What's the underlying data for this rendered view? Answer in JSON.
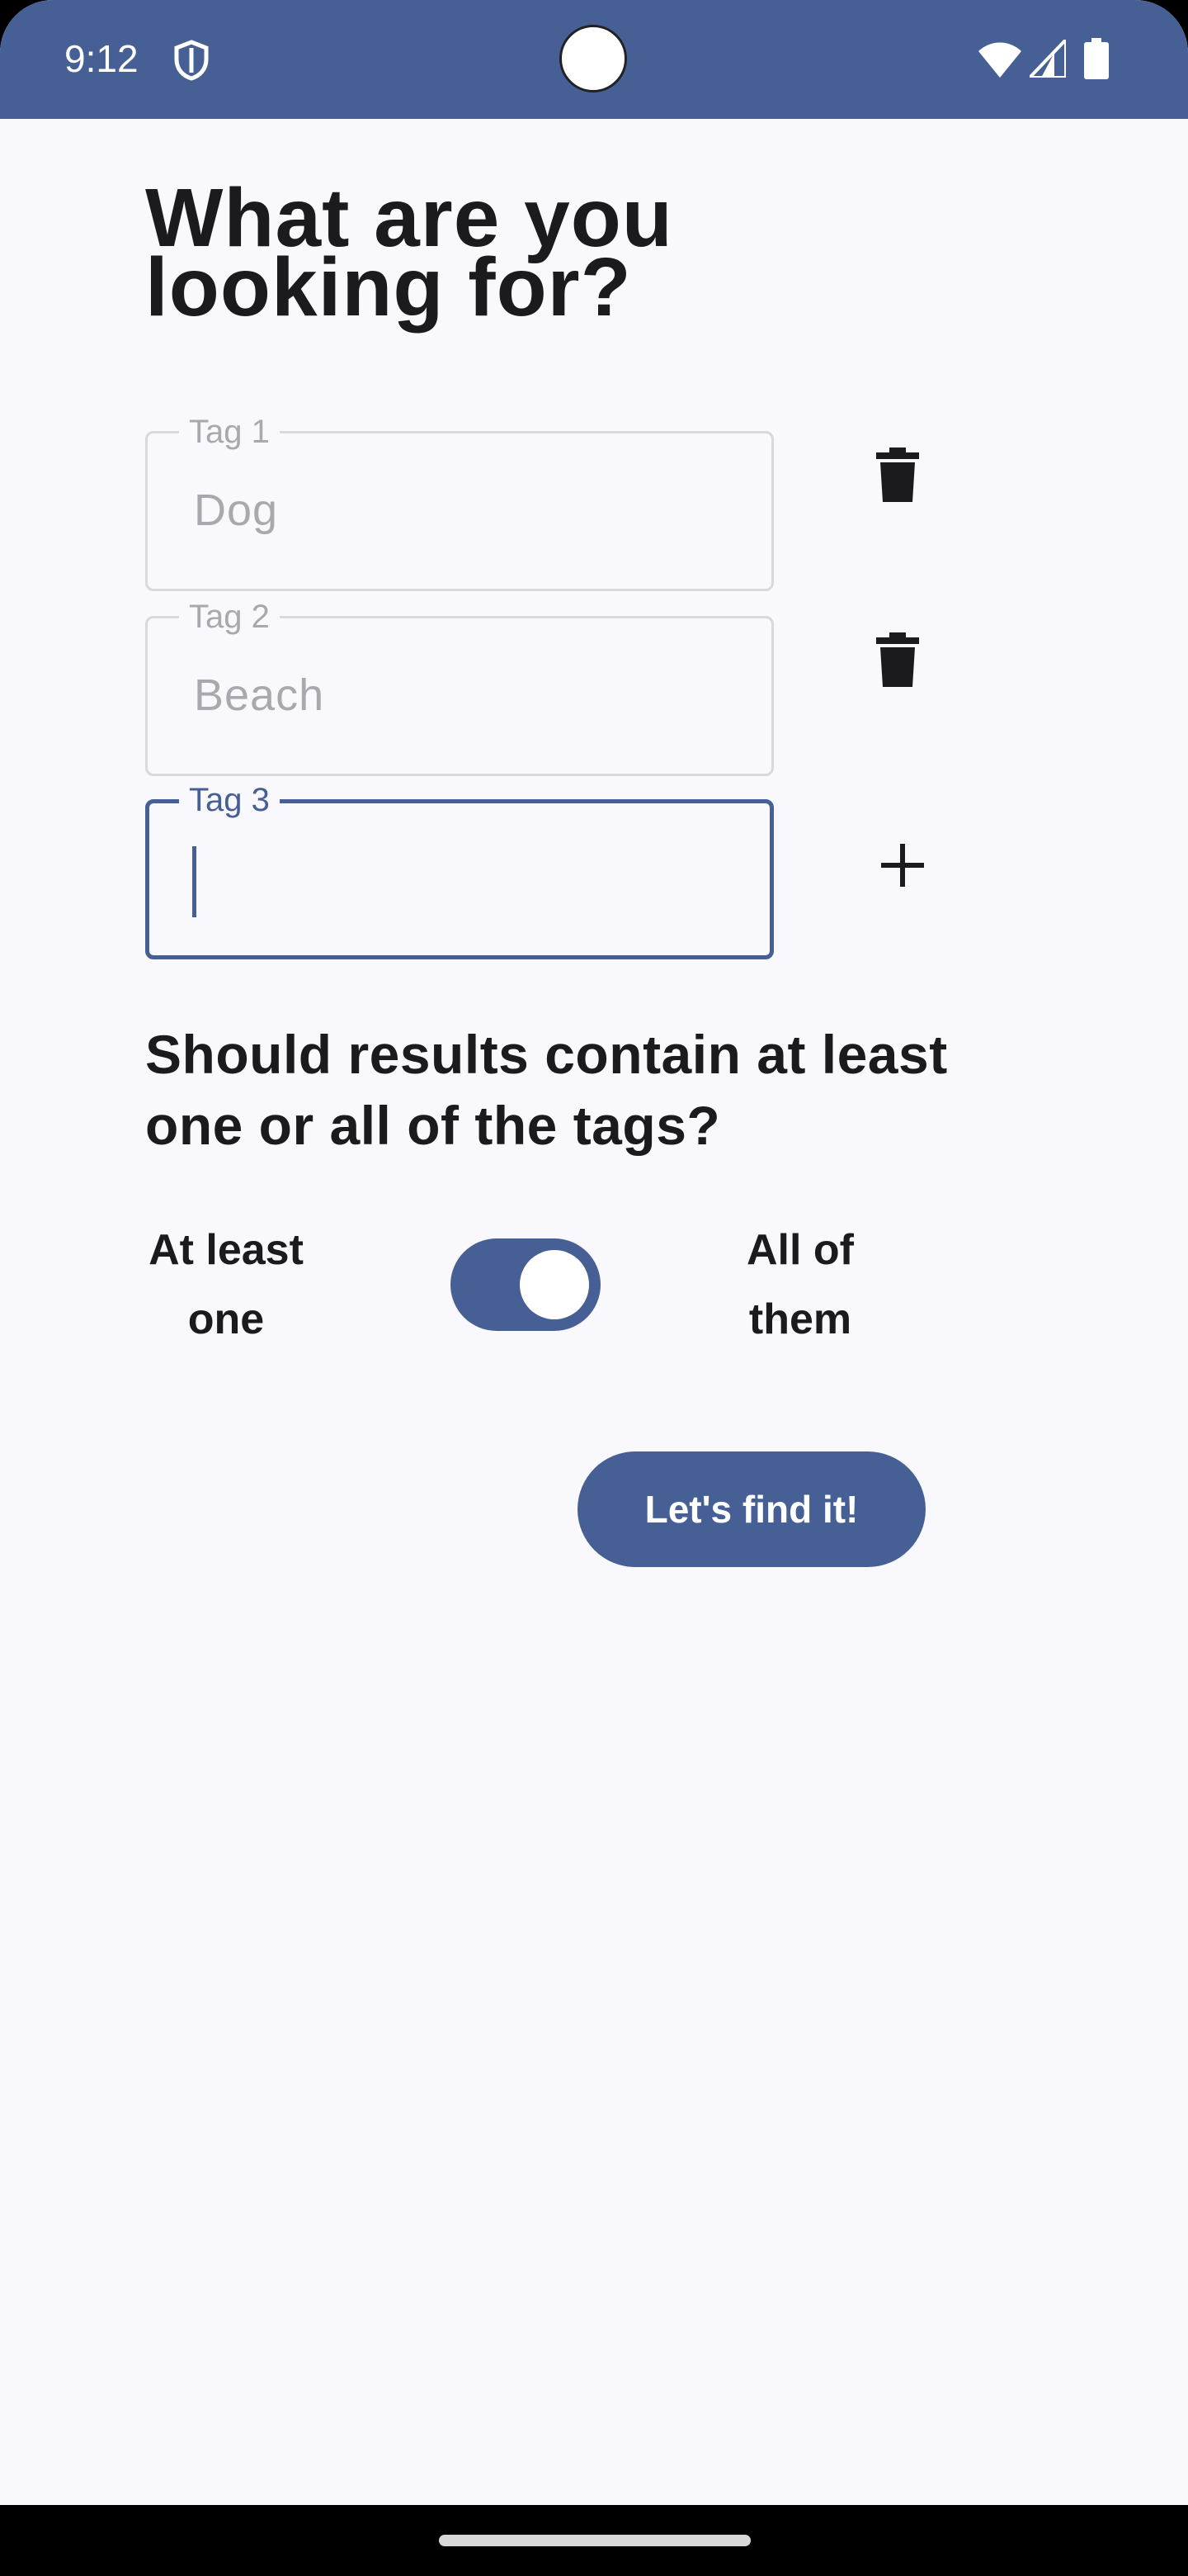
{
  "status_bar": {
    "time": "9:12",
    "icons": [
      "shield-icon",
      "wifi-icon",
      "signal-icon",
      "battery-icon"
    ]
  },
  "page": {
    "title_line1": "What are you",
    "title_line2": "looking for?"
  },
  "tags": [
    {
      "label": "Tag 1",
      "value": "Dog",
      "action": "delete-icon"
    },
    {
      "label": "Tag 2",
      "value": "Beach",
      "action": "delete-icon"
    },
    {
      "label": "Tag 3",
      "value": "",
      "action": "add-icon",
      "focused": true
    }
  ],
  "match_mode": {
    "question": "Should results contain at least one or all of the tags?",
    "option_left_line1": "At least",
    "option_left_line2": "one",
    "option_right_line1": "All of",
    "option_right_line2": "them",
    "toggle_on": true
  },
  "actions": {
    "find_label": "Let's find it!"
  },
  "colors": {
    "primary": "#465f94",
    "background": "#f9f8fd",
    "text": "#1b1b1f",
    "hint": "#a9a8ae"
  }
}
